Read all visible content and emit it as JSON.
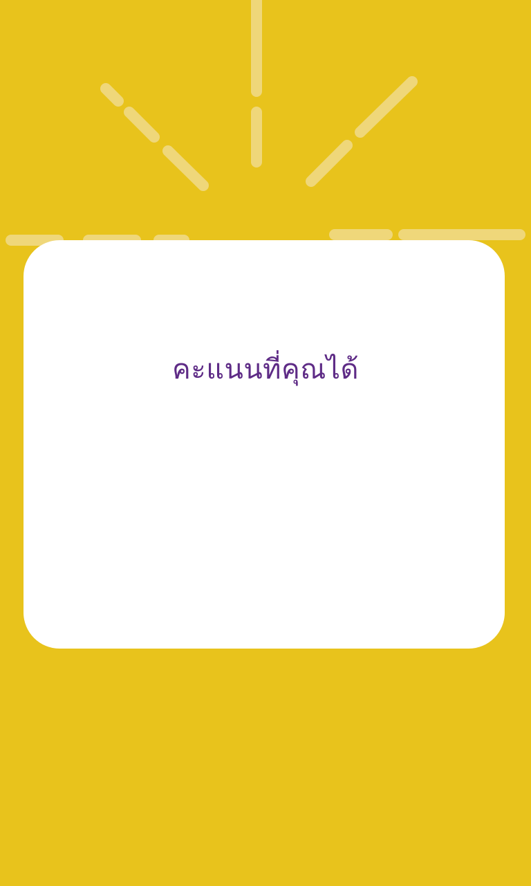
{
  "theme": {
    "background": "#E8C31C",
    "card": "#FFFFFF",
    "title_color": "#5E2B86",
    "ray_color": "#EFD77A"
  },
  "decoration": {
    "icon": "sunburst-rays"
  },
  "score_card": {
    "title": "คะแนนที่คุณได้"
  }
}
